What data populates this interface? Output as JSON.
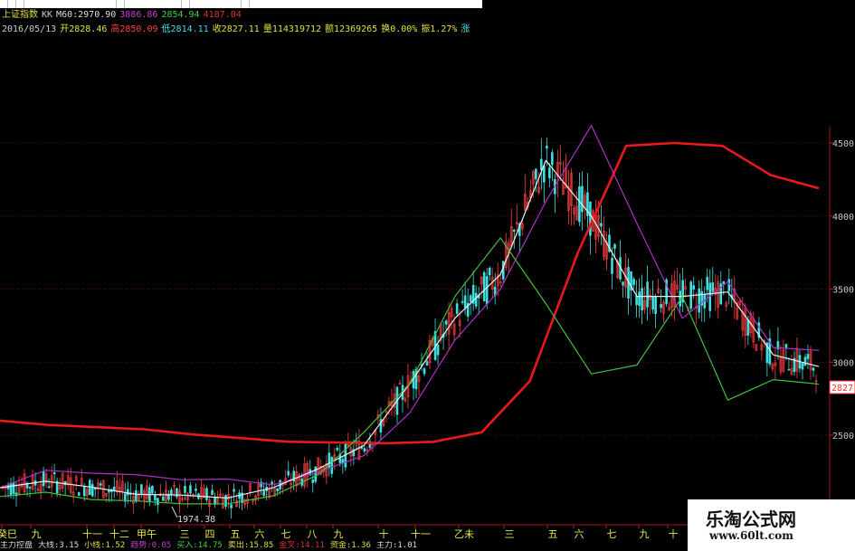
{
  "header": {
    "index_name": "上证指数",
    "indicator": "KK",
    "m60": "M60:2970.90",
    "v1": "3886.86",
    "v2": "2854.94",
    "v3": "4187.04",
    "date": "2016/05/13",
    "open": "开2828.46",
    "high": "高2850.09",
    "low": "低2814.11",
    "close": "收2827.11",
    "volume": "量114319712",
    "amount": "额12369265",
    "turnover": "换0.00%",
    "amplitude": "振1.27%",
    "rise_label": "涨"
  },
  "colors": {
    "background": "#000000",
    "up": "#ff4040",
    "down": "#40e0e0",
    "ma_long": "#e8191b",
    "upper_band": "#b030c8",
    "middle_band": "#f0f0f0",
    "lower_band": "#40c040",
    "grid": "#7a1010"
  },
  "chart_data": {
    "type": "line",
    "title": "上证指数",
    "y_ticks": [
      "4500",
      "4000",
      "3500",
      "3000",
      "2500"
    ],
    "y_range": [
      2150,
      4620
    ],
    "current_price_label": "2827.",
    "min_annotation": "1974.38",
    "x_ticks": [
      "癸巳",
      "九",
      "十一",
      "十二",
      "甲午",
      "三",
      "四",
      "五",
      "六",
      "七",
      "八",
      "九",
      "十",
      "十一",
      "乙未",
      "三",
      "五",
      "六",
      "七",
      "九",
      "十"
    ],
    "grid": true,
    "series": [
      {
        "style": "red",
        "values": [
          2600,
          2570,
          2555,
          2540,
          2505,
          2480,
          2455,
          2450,
          2445,
          2455,
          2520,
          2870,
          3750,
          4480,
          4500,
          4480,
          4280,
          4190
        ]
      },
      {
        "style": "magenta",
        "values": [
          2140,
          2260,
          2240,
          2230,
          2195,
          2200,
          2160,
          2250,
          2360,
          2650,
          3150,
          3500,
          4100,
          4620,
          3950,
          3300,
          3550,
          3100,
          3080
        ]
      },
      {
        "style": "white",
        "values": [
          2140,
          2185,
          2145,
          2095,
          2090,
          2070,
          2140,
          2270,
          2430,
          2850,
          3300,
          3600,
          4380,
          4000,
          3450,
          3450,
          3480,
          3050,
          2970
        ]
      },
      {
        "style": "green",
        "values": [
          2080,
          2110,
          2060,
          2050,
          2030,
          2030,
          2085,
          2230,
          2520,
          2850,
          3450,
          3850,
          3400,
          2920,
          2980,
          3450,
          2740,
          2880,
          2850
        ]
      }
    ]
  },
  "bottom_indicators": [
    "主力控盘",
    "大线:3.15",
    "小线:1.52",
    "趋势:0.05",
    "买入:14.75",
    "卖出:15.85",
    "金叉:14.11",
    "资金:1.36",
    "主力:1.01"
  ],
  "watermark": {
    "title": "乐淘公式网",
    "url": "www.60lt.com"
  }
}
